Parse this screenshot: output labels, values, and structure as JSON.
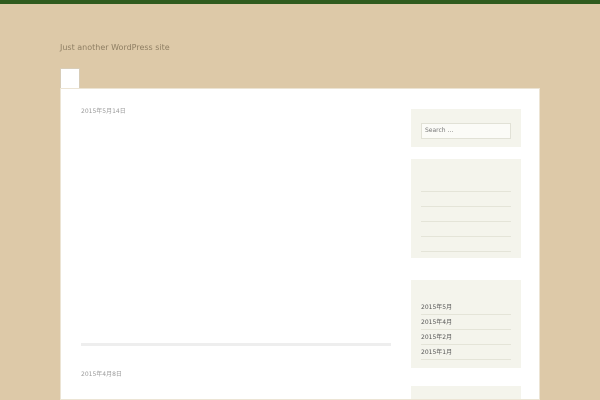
{
  "site": {
    "title": "",
    "tagline": "Just another WordPress site"
  },
  "nav": {
    "items": [
      {
        "label": ""
      }
    ]
  },
  "posts": [
    {
      "date": "2015年5月14日",
      "title": "",
      "lines": [
        "",
        "",
        "",
        "",
        "",
        "",
        "",
        "",
        "",
        "",
        "",
        "",
        "",
        "",
        "",
        ""
      ]
    },
    {
      "date": "2015年4月8日",
      "title": "",
      "lines": [
        ""
      ]
    }
  ],
  "sidebar": {
    "search": {
      "placeholder": "Search …"
    },
    "recent_posts": [
      "",
      "",
      "",
      "",
      ""
    ],
    "archives": [
      "2015年5月",
      "2015年4月",
      "2015年2月",
      "2015年1月"
    ]
  },
  "colors": {
    "background": "#ddc9a8",
    "accent": "#2f6b1e",
    "top_bar": "#2f5b1e"
  }
}
